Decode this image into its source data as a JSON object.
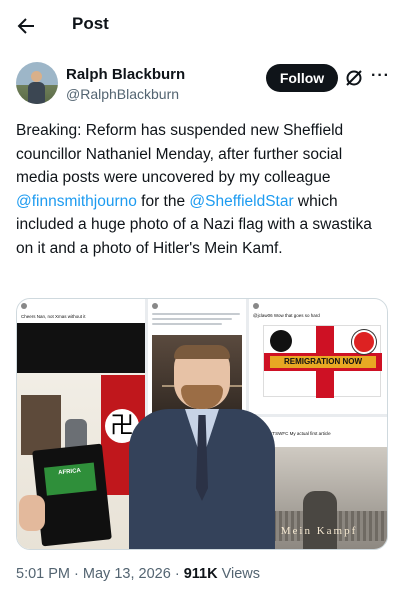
{
  "header": {
    "title": "Post",
    "back_icon": "arrow-left-icon"
  },
  "author": {
    "name": "Ralph Blackburn",
    "handle": "@RalphBlackburn",
    "follow_label": "Follow"
  },
  "tweet": {
    "part1": "Breaking: Reform has suspended new Sheffield councillor Nathaniel Menday,  after further social media posts were uncovered by my colleague ",
    "mention1": "@finnsmithjourno",
    "part2": " for the ",
    "mention2": "@SheffieldStar",
    "part3": " which included a huge photo of a Nazi flag with a swastika on it and a photo of Hitler's Mein Kamf."
  },
  "media": {
    "panel1_caption": "Cheers Nan, not Xmas without it",
    "box_label": "AFRICA",
    "panel3_caption": "@jclaw06 Wow that goes so hard",
    "banner": "REMIGRATION NOW",
    "panel4_caption": "@ConnorTSWFC My actual first article",
    "book_title": "Mein Kampf"
  },
  "meta": {
    "time": "5:01 PM",
    "date": "May 13, 2026",
    "separator": "·",
    "views_count": "911K",
    "views_label": "Views"
  },
  "colors": {
    "accent": "#1d9bf0",
    "text": "#0f1419",
    "muted": "#536471"
  }
}
